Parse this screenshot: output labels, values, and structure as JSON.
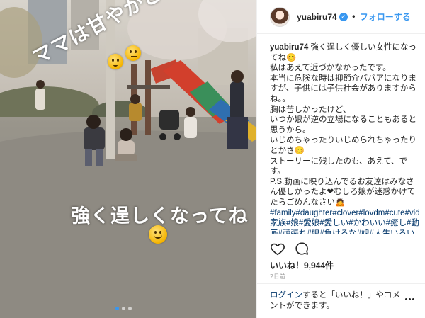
{
  "media": {
    "overlay_top": "ママは甘やかさないよ",
    "overlay_bottom": "強く逞しくなってね",
    "carousel_dots": 3,
    "active_dot": 1
  },
  "header": {
    "username": "yuabiru74",
    "separator": "•",
    "follow_label": "フォローする"
  },
  "caption": {
    "username": "yuabiru74",
    "lines": [
      "強く逞しく優しい女性になってね😊",
      "私はあえて近づかなかったです。",
      "本当に危険な時は抑節介ババアになりますが、子供には子供社会がありますからね。。",
      "胸は苦しかったけど、",
      "いつか娘が逆の立場になることもあると思うから。",
      "いじめちゃったりいじめられちゃったりとかさ😊",
      "ストーリーに残したのも、あえて、です。",
      "P.S.動画に映り込んでるお友達はみなさん優しかったよ❤むしろ娘が迷惑かけてたらごめんなさい🙇"
    ],
    "hashtags": "#family#daughter#clover#lovdm#cute#video#park#家族#娘#愛娘#愛しい#かわいい#癒し#動画#頑張れ#娘#負けるな#娘#人生いろいろ#だよ#笑#悔し涙"
  },
  "actions": {
    "like_icon": "heart-icon",
    "comment_icon": "comment-icon"
  },
  "likes": {
    "label": "いいね！9,944件"
  },
  "timestamp": "2日前",
  "footer": {
    "login_link": "ログイン",
    "text": "すると「いいね！」やコメントができます。",
    "more_icon": "more-options-icon"
  },
  "colors": {
    "link_blue": "#3897f0",
    "hashtag_navy": "#003569",
    "text": "#262626",
    "muted": "#999999"
  }
}
